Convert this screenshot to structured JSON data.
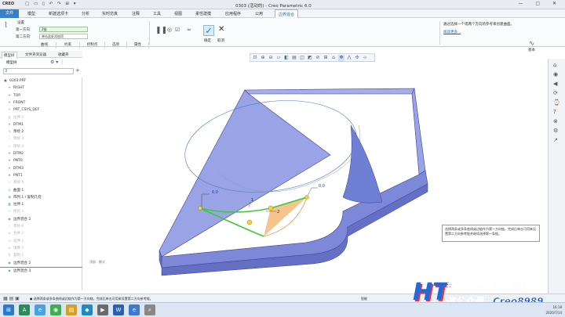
{
  "titlebar": {
    "logo": "CREO",
    "quick_access": "□ ▭ ▯ ↶ ↷ ⊞ ▾",
    "title": "0303 (活动的) - Creo Parametric 6.0",
    "window_controls": "— ▢ ✕"
  },
  "menu": {
    "items": [
      "文件",
      "模型",
      "新建选项卡",
      "分析",
      "实时仿真",
      "注释",
      "工具",
      "视图",
      "柔性建模",
      "应用程序",
      "公用",
      "边界混合"
    ],
    "active_index": 11
  },
  "ribbon": {
    "settings_label": "设置",
    "first_direction_label": "第一方向",
    "first_direction_value": "2链",
    "second_direction_label": "第二方向",
    "second_direction_value": "单击此处添加项",
    "ok_label": "确定",
    "cancel_label": "取消",
    "tabs": [
      "曲线",
      "约束",
      "控制点",
      "选项",
      "属性"
    ],
    "tips_text": "通过选择一个或两个方向的参考来创建曲面。",
    "tips_more": "阅读更多...",
    "right_mini_label": "基本"
  },
  "left_panel": {
    "tabs": [
      "模型树",
      "文件夹浏览器",
      "收藏夹"
    ],
    "tree_header": "模型树",
    "tree": [
      {
        "label": "0303.PRT",
        "icon": "▣",
        "dim": false
      },
      {
        "label": "RIGHT",
        "icon": "⌿",
        "dim": false
      },
      {
        "label": "TOP",
        "icon": "⌿",
        "dim": false
      },
      {
        "label": "FRONT",
        "icon": "⌿",
        "dim": false
      },
      {
        "label": "PRT_CSYS_DEF",
        "icon": "⊹",
        "dim": false
      },
      {
        "label": "拉伸 1",
        "icon": "▥",
        "dim": true
      },
      {
        "label": "DTM1",
        "icon": "⌿",
        "dim": false
      },
      {
        "label": "草绘 2",
        "icon": "∿",
        "dim": false
      },
      {
        "label": "草绘 3",
        "icon": "∿",
        "dim": true
      },
      {
        "label": "草绘 4",
        "icon": "∿",
        "dim": true
      },
      {
        "label": "DTM2",
        "icon": "⌿",
        "dim": false
      },
      {
        "label": "PNT0",
        "icon": "∗",
        "dim": false
      },
      {
        "label": "DTM3",
        "icon": "⌿",
        "dim": false
      },
      {
        "label": "PNT1",
        "icon": "∗",
        "dim": false
      },
      {
        "label": "草绘 5",
        "icon": "∿",
        "dim": true
      },
      {
        "label": "曲面 1",
        "icon": "◇",
        "dim": false
      },
      {
        "label": "阵列 1 / 复制几何",
        "icon": "⊞",
        "dim": false
      },
      {
        "label": "拉伸 1",
        "icon": "▥",
        "dim": false
      },
      {
        "label": "修剪 1",
        "icon": "✂",
        "dim": true
      },
      {
        "label": "边界混合 2",
        "icon": "◈",
        "dim": false
      },
      {
        "label": "草绘 6",
        "icon": "∿",
        "dim": true
      },
      {
        "label": "合并 1",
        "icon": "⊕",
        "dim": true
      },
      {
        "label": "延伸 1",
        "icon": "⇥",
        "dim": true
      },
      {
        "label": "镜像 1",
        "icon": "⇌",
        "dim": true
      },
      {
        "label": "复制 1",
        "icon": "⎘",
        "dim": true
      },
      {
        "label": "边界混合 2",
        "icon": "◈",
        "dim": false
      },
      {
        "label": "边界混合 3",
        "icon": "◈",
        "dim": false,
        "insert": true
      }
    ]
  },
  "viewport": {
    "note": "顶部 : 模式",
    "dims": [
      "0.0",
      "0.0"
    ],
    "chain_labels": [
      "1",
      "2"
    ],
    "tooltip": "选择两条或多条曲线或边链作为第一方向链。完成后单击可用来设置第二方向参考链并继续选择第一条链。"
  },
  "statusbar": {
    "message": "● 选择两条或多条曲线或边链作为第一方向链。完成后单击可用来设置第二方向参考链。",
    "selection": "智能"
  },
  "watermark": {
    "logo": "HT",
    "line1": "想要学习更多请关注微",
    "line2": "信公众号：Creo8989"
  },
  "taskbar": {
    "clock_time": "16:18",
    "clock_date": "2020/7/14"
  },
  "colors": {
    "accent_blue": "#3b7fc4",
    "surface_blue": "#7b86d6",
    "chain_green": "#3ec83e",
    "fill_orange": "#f6bf80"
  }
}
